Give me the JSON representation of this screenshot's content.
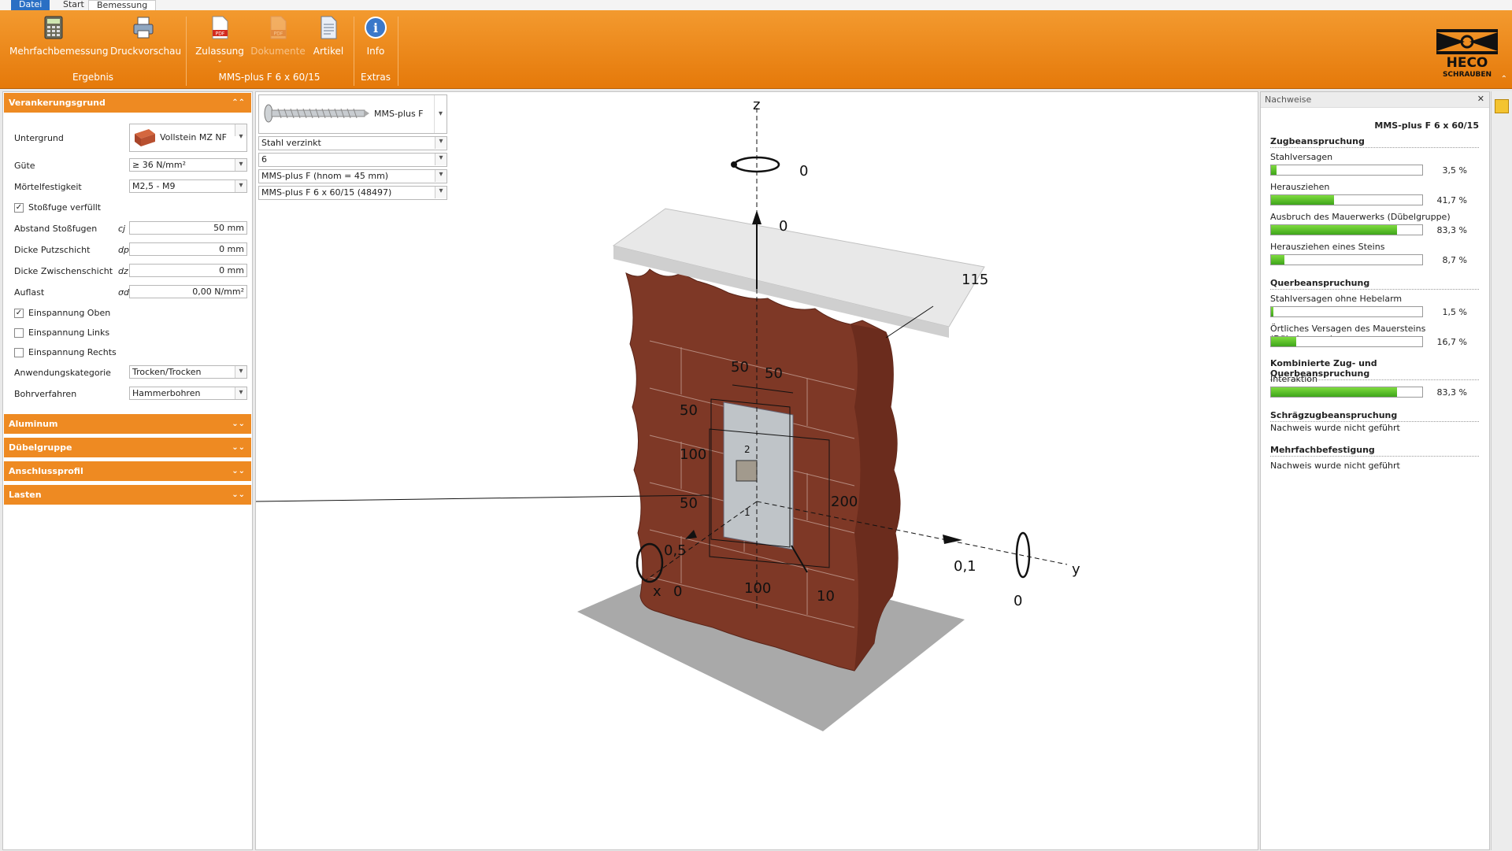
{
  "tabs": [
    "Datei",
    "Start",
    "Bemessung"
  ],
  "ribbon": {
    "buttons": [
      {
        "label": "Mehrfachbemessung",
        "icon": "calculator-icon"
      },
      {
        "label": "Druckvorschau",
        "icon": "printer-icon"
      },
      {
        "label": "Zulassung",
        "icon": "pdf-icon"
      },
      {
        "label": "Dokumente",
        "icon": "pdf-disabled-icon"
      },
      {
        "label": "Artikel",
        "icon": "document-icon"
      },
      {
        "label": "Info",
        "icon": "info-icon"
      }
    ],
    "groups": [
      "Ergebnis",
      "MMS-plus F 6 x 60/15",
      "Extras"
    ],
    "logo_text_1": "HECO",
    "logo_text_2": "SCHRAUBEN"
  },
  "left": {
    "section_main": "Verankerungsgrund",
    "untergrund_label": "Untergrund",
    "untergrund_value": "Vollstein MZ NF",
    "guete_label": "Güte",
    "guete_value": "≥ 36 N/mm²",
    "moertel_label": "Mörtelfestigkeit",
    "moertel_value": "M2,5 - M9",
    "stossfuge_label": "Stoßfuge verfüllt",
    "abstand_label": "Abstand Stoßfugen",
    "abstand_sym": "cj",
    "abstand_value": "50 mm",
    "putz_label": "Dicke Putzschicht",
    "putz_sym": "dp",
    "putz_value": "0 mm",
    "zwischen_label": "Dicke Zwischenschicht",
    "zwischen_sym": "dz",
    "zwischen_value": "0 mm",
    "auflast_label": "Auflast",
    "auflast_sym": "σd",
    "auflast_value": "0,00 N/mm²",
    "einsp_oben": "Einspannung Oben",
    "einsp_links": "Einspannung Links",
    "einsp_rechts": "Einspannung Rechts",
    "anwendung_label": "Anwendungskategorie",
    "anwendung_value": "Trocken/Trocken",
    "bohr_label": "Bohrverfahren",
    "bohr_value": "Hammerbohren",
    "sections": [
      "Aluminum",
      "Dübelgruppe",
      "Anschlussprofil",
      "Lasten"
    ]
  },
  "center": {
    "product": "MMS-plus F",
    "material": "Stahl verzinkt",
    "diameter": "6",
    "hnom": "MMS-plus F (hnom = 45 mm)",
    "article": "MMS-plus F 6 x 60/15 (48497)",
    "axis_z": "z",
    "axis_x": "x",
    "axis_y": "y",
    "labels": {
      "mz": "0",
      "fz": "0",
      "dim115": "115",
      "d50a": "50",
      "d50b": "50",
      "d50c": "50",
      "d100a": "100",
      "d50d": "50",
      "d200": "200",
      "d100b": "100",
      "d10": "10",
      "fx": "0,5",
      "mx": "0",
      "fy": "0,1",
      "my": "0",
      "n1": "1",
      "n2": "2"
    }
  },
  "right": {
    "title": "Nachweise",
    "product": "MMS-plus F 6 x 60/15",
    "zug_head": "Zugbeanspruchung",
    "zug": [
      {
        "label": "Stahlversagen",
        "value": "3,5 %",
        "fill": 0.035
      },
      {
        "label": "Herausziehen",
        "value": "41,7 %",
        "fill": 0.417
      },
      {
        "label": "Ausbruch des Mauerwerks (Dübelgruppe)",
        "value": "83,3 %",
        "fill": 0.833
      },
      {
        "label": "Herausziehen eines Steins",
        "value": "8,7 %",
        "fill": 0.087
      }
    ],
    "quer_head": "Querbeanspruchung",
    "quer": [
      {
        "label": "Stahlversagen ohne Hebelarm",
        "value": "1,5 %",
        "fill": 0.015
      },
      {
        "label": "Örtliches Versagen des Mauersteins (Dübelgruppe)",
        "value": "16,7 %",
        "fill": 0.167
      }
    ],
    "komb_head": "Kombinierte Zug- und Querbeanspruchung",
    "komb": [
      {
        "label": "Interaktion",
        "value": "83,3 %",
        "fill": 0.833
      }
    ],
    "schraeg_head": "Schrägzugbeanspruchung",
    "schraeg_text": "Nachweis wurde nicht geführt",
    "mehr_head": "Mehrfachbefestigung",
    "mehr_text": "Nachweis wurde nicht geführt"
  },
  "colors": {
    "accent": "#ee8a22",
    "brick": "#8a3a22",
    "bar": "#3ea51a"
  }
}
